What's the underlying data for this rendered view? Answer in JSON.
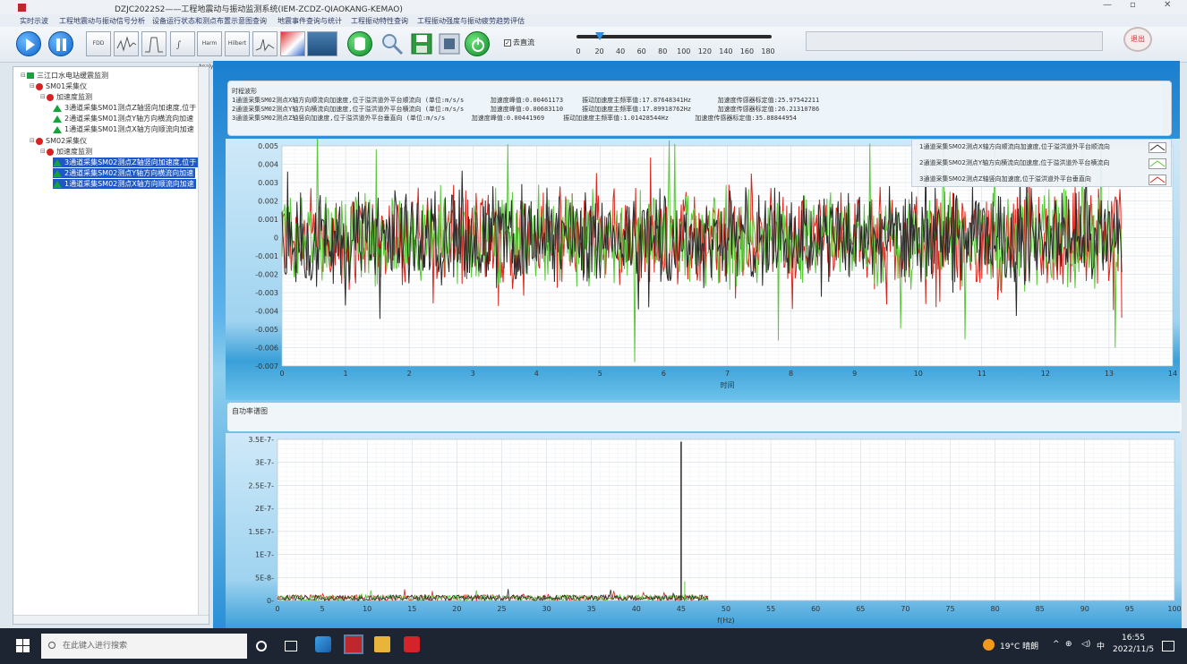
{
  "window": {
    "title": "DZJC2022S2——工程地震动与振动监测系统(IEM-ZCDZ-QIAOKANG-KEMAO)"
  },
  "menu": {
    "items": [
      "实时示波",
      "工程地震动与振动信号分析",
      "设备运行状态和测点布置示意图查询",
      "地震事件查询与统计",
      "工程振动特性查询",
      "工程振动强度与振动疲劳趋势评估"
    ]
  },
  "toolbar": {
    "buttons": [
      "play",
      "pause",
      "FDD",
      "Wave",
      "Filter",
      "JSD",
      "Harm Analysis",
      "Hilbert",
      "Spectrum",
      "Tool",
      "Screen",
      "Database",
      "Search",
      "Save",
      "Export",
      "Power"
    ],
    "button_labels": {
      "fdd": "FDD",
      "harm": "Harm Analysis",
      "hilbert": "Hilbert"
    },
    "dc_checkbox_label": "去直流",
    "dc_checked": true,
    "slider_ticks": [
      "0",
      "20",
      "40",
      "60",
      "80",
      "100",
      "120",
      "140",
      "160",
      "180"
    ],
    "slider_value": 20,
    "exit_label": "退出"
  },
  "tree": {
    "root": "三江口水电站缓震监测",
    "sm01": "SM01采集仪",
    "sm01_group": "加速度监测",
    "sm01_ch3": "3通道采集SM01测点Z轴竖向加速度,位于",
    "sm01_ch2": "2通道采集SM01测点Y轴方向横流向加速",
    "sm01_ch1": "1通道采集SM01测点X轴方向顺流向加速",
    "sm02": "SM02采集仪",
    "sm02_group": "加速度监测",
    "sm02_ch3": "3通道采集SM02测点Z轴竖向加速度,位于",
    "sm02_ch2": "2通道采集SM02测点Y轴方向横流向加速",
    "sm02_ch1": "1通道采集SM02测点X轴方向顺流向加速"
  },
  "info": {
    "header": "时程波形",
    "lines": [
      "1通道采集SM02测点X轴方向顺流向加速度,位于溢洪道外平台顺流向 (单位:m/s/s       加速度峰值:0.00461173     振动加速度主频率值:17.87648341Hz       加速度传感器标定值:25.97542211",
      "2通道采集SM02测点Y轴方向横流向加速度,位于溢洪道外平台横流向 (单位:m/s/s       加速度峰值:0.00683110     振动加速度主频率值:17.89918762Hz       加速度传感器标定值:26.21310786",
      "3通道采集SM02测点Z轴竖向加速度,位于溢洪道外平台垂直向 (单位:m/s/s       加速度峰值:0.00441969     振动加速度主频率值:1.01428544Hz       加速度传感器标定值:35.88844954"
    ]
  },
  "legend": {
    "items": [
      {
        "label": "1通道采集SM02测点X轴方向顺流向加速度,位于溢洪道外平台顺流向",
        "color": "#2a2a2a"
      },
      {
        "label": "2通道采集SM02测点Y轴方向横流向加速度,位于溢洪道外平台横流向",
        "color": "#5ac83a"
      },
      {
        "label": "3通道采集SM02测点Z轴竖向加速度,位于溢洪道外平台垂直向",
        "color": "#d9261c"
      }
    ]
  },
  "spectrum": {
    "header": "自功率谱图"
  },
  "chart_data": [
    {
      "type": "line",
      "title": "",
      "xlabel": "时间",
      "ylabel": "",
      "xlim": [
        0,
        14
      ],
      "ylim": [
        -0.007,
        0.005
      ],
      "x_ticks": [
        "0",
        "1",
        "2",
        "3",
        "4",
        "5",
        "6",
        "7",
        "8",
        "9",
        "10",
        "11",
        "12",
        "13",
        "14"
      ],
      "y_ticks": [
        "-0.007",
        "-0.006",
        "-0.005",
        "-0.004",
        "-0.003",
        "-0.002",
        "-0.001",
        "0",
        "0.001",
        "0.002",
        "0.003",
        "0.004",
        "0.005"
      ],
      "grid": true,
      "x_data_end": 13.2,
      "series": [
        {
          "color": "#d9261c",
          "peak": 0.0044
        },
        {
          "color": "#5ac83a",
          "peak": 0.0068
        },
        {
          "color": "#2a2a2a",
          "peak": 0.0046
        }
      ]
    },
    {
      "type": "line",
      "title": "",
      "xlabel": "f(Hz)",
      "ylabel": "",
      "xlim": [
        0,
        100
      ],
      "ylim": [
        0,
        3.5e-07
      ],
      "x_ticks": [
        "0",
        "5",
        "10",
        "15",
        "20",
        "25",
        "30",
        "35",
        "40",
        "45",
        "50",
        "55",
        "60",
        "65",
        "70",
        "75",
        "80",
        "85",
        "90",
        "95",
        "100"
      ],
      "y_ticks": [
        "0",
        "5E-8",
        "1E-7",
        "1.5E-7",
        "2E-7",
        "2.5E-7",
        "3E-7",
        "3.5E-7"
      ],
      "grid": true,
      "x_data_end": 48,
      "peak": {
        "x": 45,
        "y": 3.45e-07
      }
    }
  ],
  "taskbar": {
    "search_placeholder": "在此键入进行搜索",
    "weather": "19°C 晴朗",
    "ime": "中",
    "time": "16:55",
    "date": "2022/11/5"
  }
}
